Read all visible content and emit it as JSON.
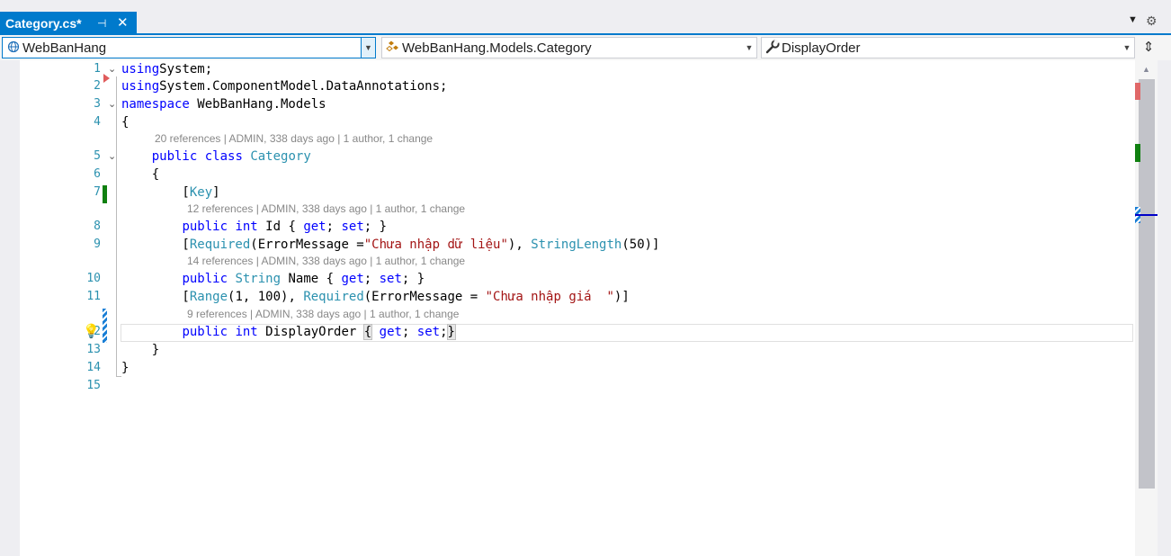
{
  "tab": {
    "title": "Category.cs*",
    "pin_glyph": "⊣",
    "close_glyph": "✕"
  },
  "strip": {
    "dropdown_glyph": "▼",
    "settings_glyph": "⚙"
  },
  "navbar": {
    "project": {
      "text": "WebBanHang",
      "icon": "project-icon"
    },
    "type": {
      "text": "WebBanHang.Models.Category",
      "icon": "class-icon"
    },
    "member": {
      "text": "DisplayOrder",
      "icon": "wrench-icon"
    },
    "split_glyph": "⇕"
  },
  "lines": [
    {
      "num": "1",
      "tokens": [
        [
          "kw",
          "using"
        ],
        [
          "",
          "System;"
        ]
      ]
    },
    {
      "num": "2",
      "tokens": [
        [
          "kw",
          "using"
        ],
        [
          "",
          "System.ComponentModel.DataAnnotations;"
        ]
      ]
    },
    {
      "num": "3",
      "tokens": [
        [
          "kw",
          "namespace"
        ],
        [
          "",
          " WebBanHang.Models"
        ]
      ]
    },
    {
      "num": "4",
      "tokens": [
        [
          "",
          "{"
        ]
      ]
    },
    {
      "num": "5",
      "tokens": [
        [
          "",
          "    "
        ],
        [
          "kw",
          "public"
        ],
        [
          "",
          " "
        ],
        [
          "kw",
          "class"
        ],
        [
          "",
          " "
        ],
        [
          "ty",
          "Category"
        ]
      ]
    },
    {
      "num": "6",
      "tokens": [
        [
          "",
          "    {"
        ]
      ]
    },
    {
      "num": "7",
      "tokens": [
        [
          "",
          "        ["
        ],
        [
          "ty",
          "Key"
        ],
        [
          "",
          "]"
        ]
      ]
    },
    {
      "num": "8",
      "tokens": [
        [
          "",
          "        "
        ],
        [
          "kw",
          "public"
        ],
        [
          "",
          " "
        ],
        [
          "kw",
          "int"
        ],
        [
          "",
          " Id { "
        ],
        [
          "kw",
          "get"
        ],
        [
          "",
          "; "
        ],
        [
          "kw",
          "set"
        ],
        [
          "",
          "; }"
        ]
      ]
    },
    {
      "num": "9",
      "tokens": [
        [
          "",
          "        ["
        ],
        [
          "ty",
          "Required"
        ],
        [
          "",
          "(ErrorMessage ="
        ],
        [
          "st",
          "\"Chưa nhập dữ liệu\""
        ],
        [
          "",
          "), "
        ],
        [
          "ty",
          "StringLength"
        ],
        [
          "",
          "(50)]"
        ]
      ]
    },
    {
      "num": "10",
      "tokens": [
        [
          "",
          "        "
        ],
        [
          "kw",
          "public"
        ],
        [
          "",
          " "
        ],
        [
          "ty",
          "String"
        ],
        [
          "",
          " Name { "
        ],
        [
          "kw",
          "get"
        ],
        [
          "",
          "; "
        ],
        [
          "kw",
          "set"
        ],
        [
          "",
          "; }"
        ]
      ]
    },
    {
      "num": "11",
      "tokens": [
        [
          "",
          "        ["
        ],
        [
          "ty",
          "Range"
        ],
        [
          "",
          "(1, 100), "
        ],
        [
          "ty",
          "Required"
        ],
        [
          "",
          "(ErrorMessage = "
        ],
        [
          "st",
          "\"Chưa nhập giá  \""
        ],
        [
          "",
          ")]"
        ]
      ]
    },
    {
      "num": "12",
      "tokens": [
        [
          "",
          "        "
        ],
        [
          "kw",
          "public"
        ],
        [
          "",
          " "
        ],
        [
          "kw",
          "int"
        ],
        [
          "",
          " DisplayOrder "
        ],
        [
          "hl",
          "{"
        ],
        [
          "",
          " "
        ],
        [
          "kw",
          "get"
        ],
        [
          "",
          "; "
        ],
        [
          "kw",
          "set"
        ],
        [
          "",
          ";"
        ],
        [
          "hl",
          "}"
        ]
      ]
    },
    {
      "num": "13",
      "tokens": [
        [
          "",
          "    }"
        ]
      ]
    },
    {
      "num": "14",
      "tokens": [
        [
          "",
          "}"
        ]
      ]
    },
    {
      "num": "15",
      "tokens": []
    }
  ],
  "codelens": [
    {
      "after_line": "4",
      "text": "20 references | ADMIN, 338 days ago | 1 author, 1 change"
    },
    {
      "after_line": "7",
      "text": "12 references | ADMIN, 338 days ago | 1 author, 1 change"
    },
    {
      "after_line": "9",
      "text": "14 references | ADMIN, 338 days ago | 1 author, 1 change"
    },
    {
      "after_line": "11",
      "text": "9 references | ADMIN, 338 days ago | 1 author, 1 change"
    }
  ],
  "colors": {
    "accent": "#007acc",
    "keyword": "#0000ff",
    "type": "#2b91af",
    "string": "#a31515",
    "line_number": "#2b91af",
    "codelens": "#888888"
  }
}
